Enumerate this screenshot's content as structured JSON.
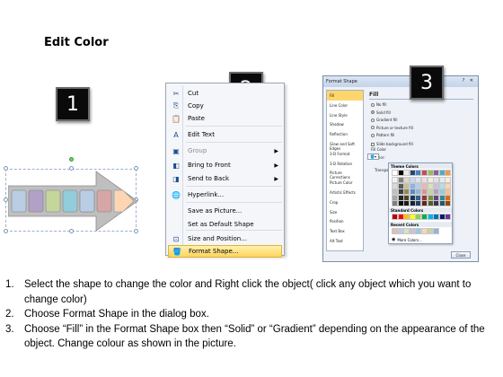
{
  "slide": {
    "title": "Edit Color"
  },
  "steps": {
    "badge_1": "1",
    "badge_2": "2",
    "badge_3": "3"
  },
  "context_menu": {
    "items": [
      {
        "label": "Cut",
        "icon": "scissors-icon",
        "glyph": "✂",
        "enabled": true
      },
      {
        "label": "Copy",
        "icon": "copy-icon",
        "glyph": "⎘",
        "enabled": true
      },
      {
        "label": "Paste",
        "icon": "clipboard-icon",
        "glyph": "📋",
        "enabled": true
      },
      {
        "label": "Edit Text",
        "icon": "edit-text-icon",
        "glyph": "A",
        "enabled": true
      },
      {
        "label": "Group",
        "icon": "group-icon",
        "glyph": "▣",
        "enabled": false,
        "submenu": true
      },
      {
        "label": "Bring to Front",
        "icon": "bring-front-icon",
        "glyph": "◧",
        "enabled": true,
        "submenu": true
      },
      {
        "label": "Send to Back",
        "icon": "send-back-icon",
        "glyph": "◨",
        "enabled": true,
        "submenu": true
      },
      {
        "label": "Hyperlink...",
        "icon": "hyperlink-icon",
        "glyph": "🌐",
        "enabled": true
      },
      {
        "label": "Save as Picture...",
        "icon": "",
        "glyph": "",
        "enabled": true
      },
      {
        "label": "Set as Default Shape",
        "icon": "",
        "glyph": "",
        "enabled": true
      },
      {
        "label": "Size and Position...",
        "icon": "size-position-icon",
        "glyph": "⊡",
        "enabled": true
      },
      {
        "label": "Format Shape...",
        "icon": "paint-bucket-icon",
        "glyph": "🪣",
        "enabled": true,
        "highlighted": true
      }
    ]
  },
  "format_dialog": {
    "title": "Format Shape",
    "window_buttons": "? ✕",
    "categories": [
      "Fill",
      "Line Color",
      "Line Style",
      "Shadow",
      "Reflection",
      "Glow and Soft Edges",
      "3-D Format",
      "3-D Rotation",
      "Picture Corrections",
      "Picture Color",
      "Artistic Effects",
      "Crop",
      "Size",
      "Position",
      "Text Box",
      "Alt Text"
    ],
    "selected_category": "Fill",
    "fill_heading": "Fill",
    "fill_options": [
      "No fill",
      "Solid fill",
      "Gradient fill",
      "Picture or texture fill",
      "Pattern fill"
    ],
    "selected_fill": "Solid fill",
    "slide_background_fill": "Slide background fill",
    "fill_color_label": "Fill Color",
    "color_label": "Color:",
    "transparency_label": "Transpar",
    "close_label": "Close"
  },
  "palette": {
    "theme_heading": "Theme Colors",
    "standard_heading": "Standard Colors",
    "recent_heading": "Recent Colors",
    "more_colors": "More Colors...",
    "theme_top": [
      "#ffffff",
      "#000000",
      "#eeece1",
      "#1f497d",
      "#4f81bd",
      "#c0504d",
      "#9bbb59",
      "#8064a2",
      "#4bacc6",
      "#f79646"
    ],
    "theme_columns": [
      [
        "#f2f2f2",
        "#d9d9d9",
        "#bfbfbf",
        "#a6a6a6",
        "#7f7f7f"
      ],
      [
        "#7f7f7f",
        "#595959",
        "#404040",
        "#262626",
        "#0d0d0d"
      ],
      [
        "#ddd9c3",
        "#c4bd97",
        "#948a54",
        "#4a452a",
        "#1e1c11"
      ],
      [
        "#c6d9f0",
        "#8db3e2",
        "#548dd4",
        "#17365d",
        "#0f243e"
      ],
      [
        "#dbe5f1",
        "#b8cce4",
        "#95b3d7",
        "#366092",
        "#244061"
      ],
      [
        "#f2dcdb",
        "#e5b9b7",
        "#d99694",
        "#953734",
        "#632423"
      ],
      [
        "#ebf1dd",
        "#d7e3bc",
        "#c3d69b",
        "#76923c",
        "#4f6128"
      ],
      [
        "#e5e0ec",
        "#ccc1d9",
        "#b2a2c7",
        "#5f497a",
        "#3f3151"
      ],
      [
        "#dbeef3",
        "#b7dde8",
        "#92cddc",
        "#31859b",
        "#205867"
      ],
      [
        "#fdeada",
        "#fbd5b5",
        "#fac08f",
        "#e36c09",
        "#974806"
      ]
    ],
    "standard": [
      "#c00000",
      "#ff0000",
      "#ffc000",
      "#ffff00",
      "#92d050",
      "#00b050",
      "#00b0f0",
      "#0070c0",
      "#002060",
      "#7030a0"
    ],
    "recent": [
      "#e6b9b8",
      "#b9cde5",
      "#d7e4bd",
      "#ccc1da",
      "#93cddd",
      "#fcd5b5",
      "#c3d69b",
      "#8eb4e3"
    ]
  },
  "shape": {
    "segment_colors": [
      "#b9cde5",
      "#b2a1c7",
      "#c3d69b",
      "#92cddc",
      "#d6a6a6",
      "#fcd5b5"
    ],
    "body_color": "#bfbfbf"
  },
  "instructions": [
    {
      "num": "1.",
      "text": "Select the shape to change the color and Right click the object( click any object which you want to change color)"
    },
    {
      "num": "2.",
      "text": "Choose Format Shape in the dialog box."
    },
    {
      "num": "3.",
      "text": "Choose “Fill” in the Format Shape box then “Solid” or “Gradient” depending on the appearance of the object. Change colour as shown in the picture."
    }
  ]
}
